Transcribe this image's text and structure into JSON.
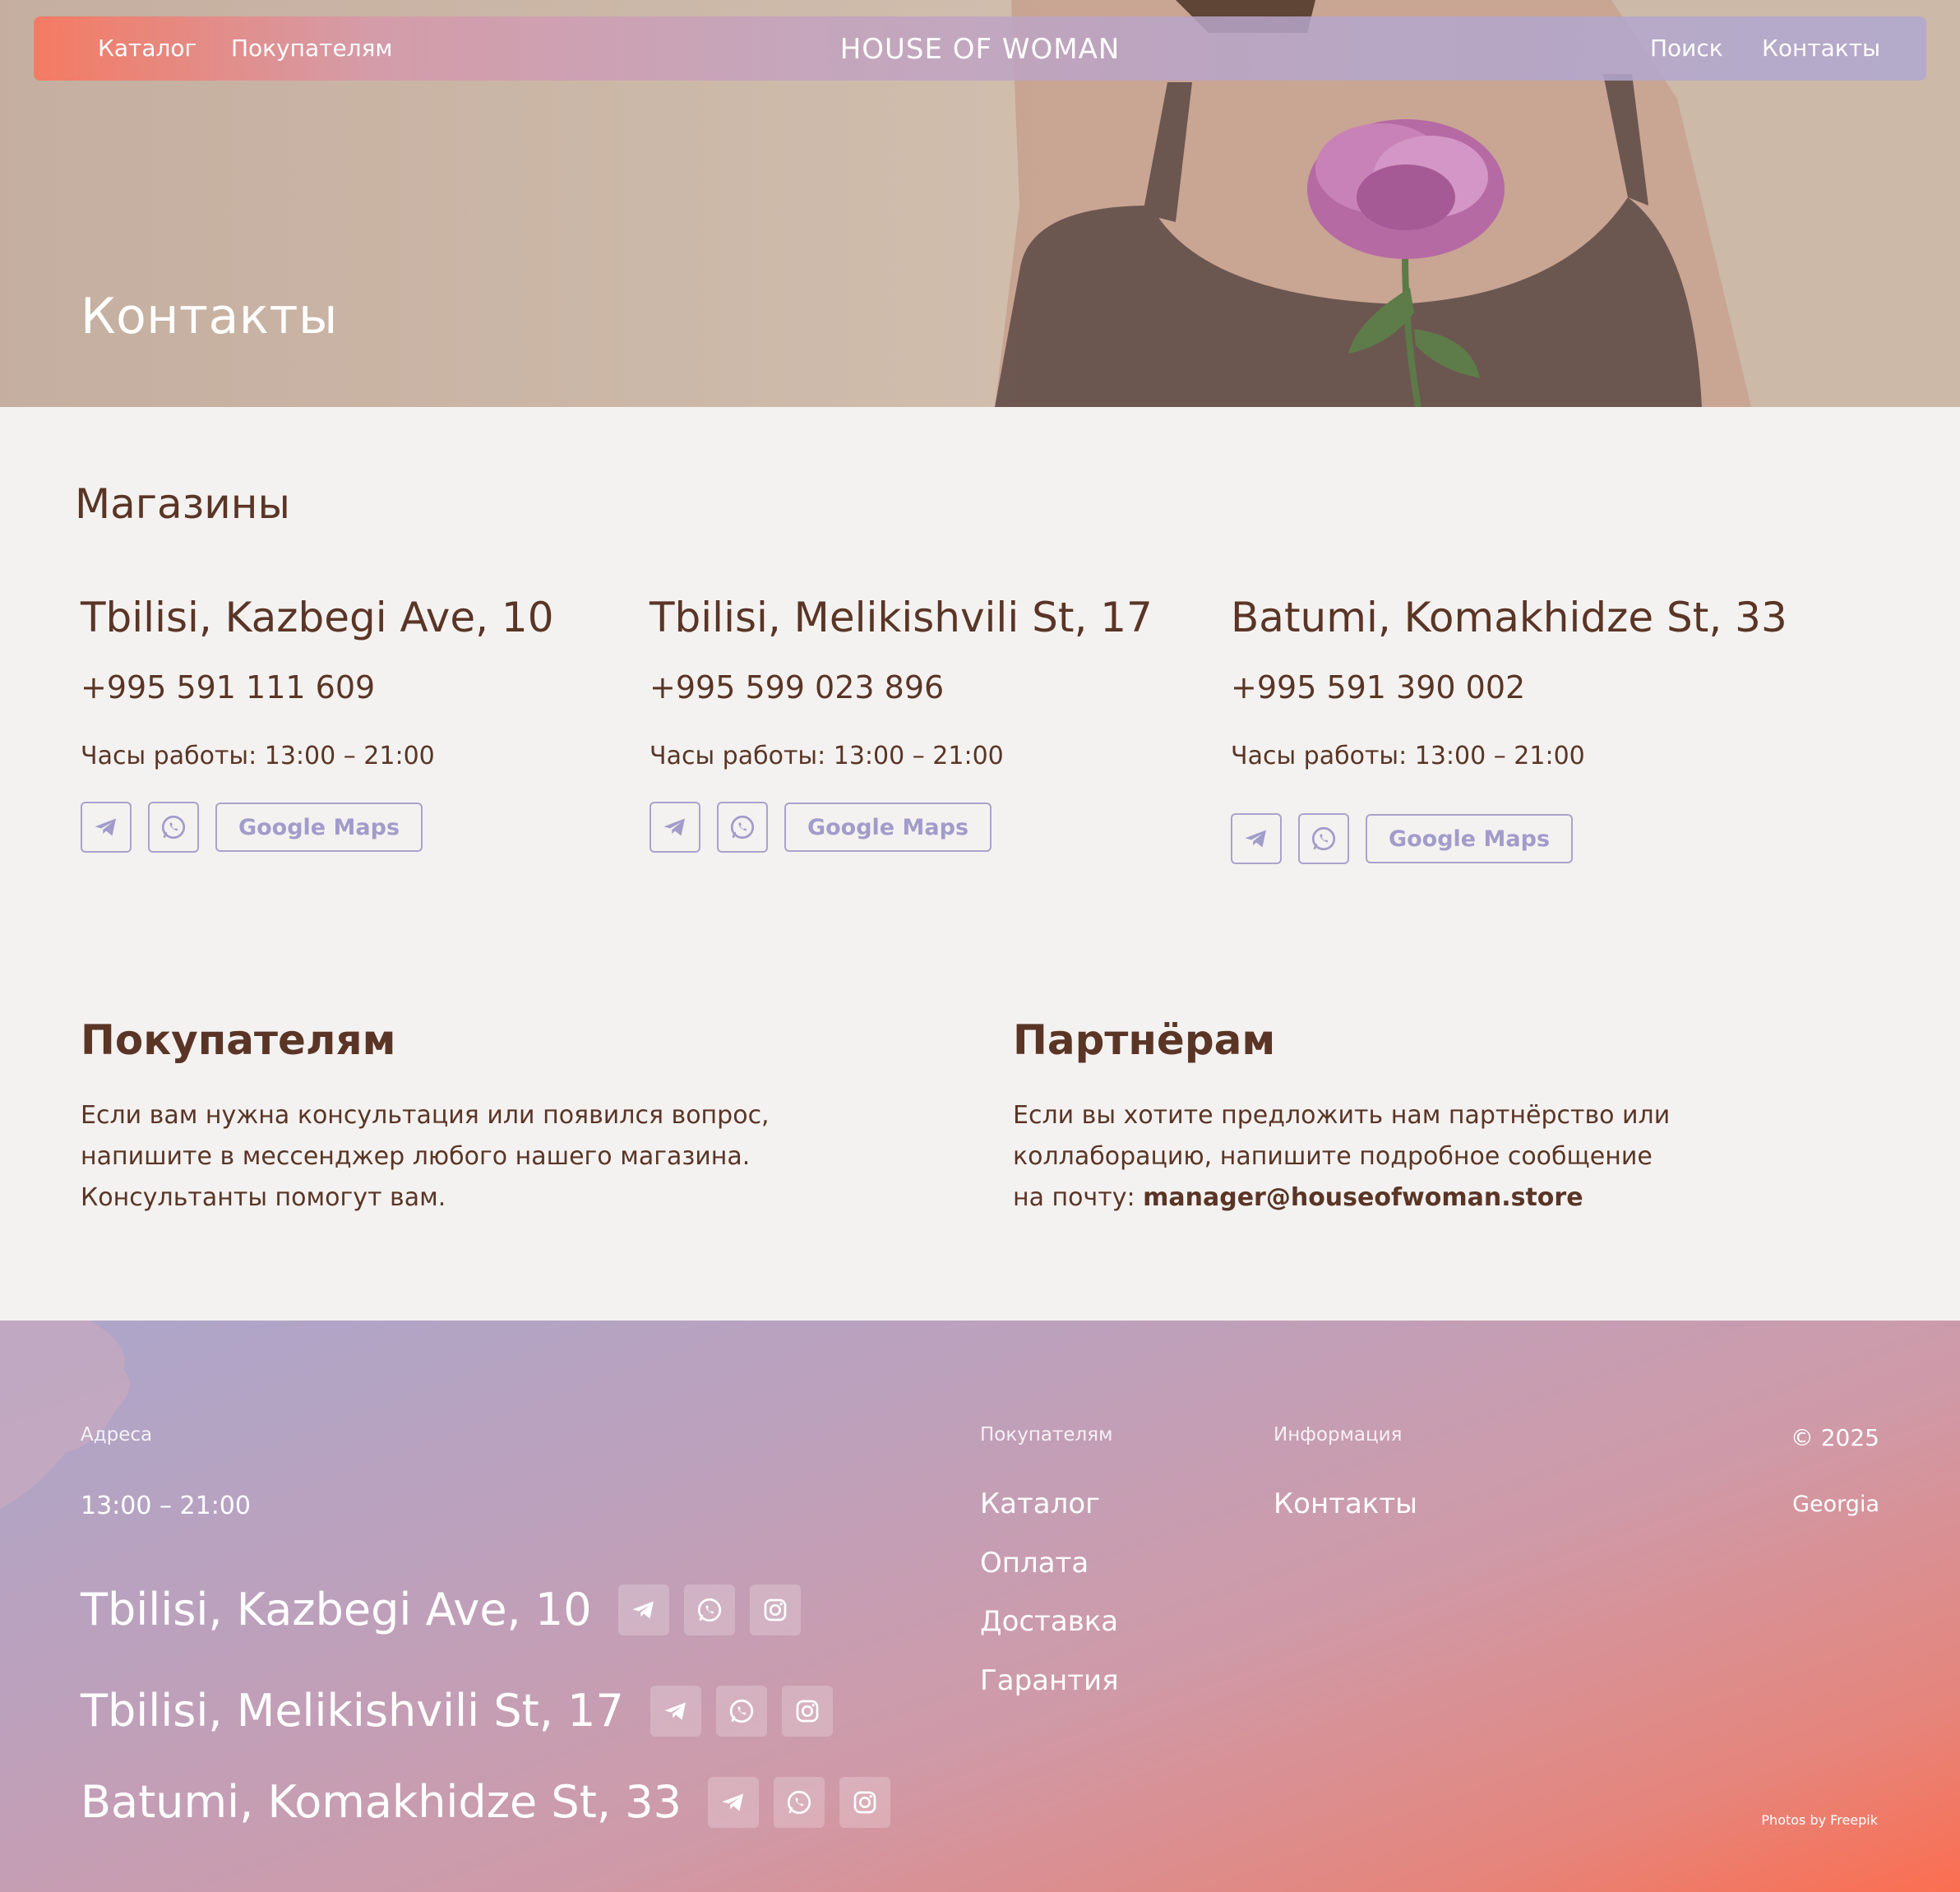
{
  "nav": {
    "catalog": "Каталог",
    "customers": "Покупателям",
    "brand": "HOUSE OF WOMAN",
    "search": "Поиск",
    "contacts": "Контакты"
  },
  "hero": {
    "title": "Контакты"
  },
  "stores": {
    "title": "Магазины",
    "items": [
      {
        "name": "Tbilisi, Kazbegi Ave, 10",
        "phone": "+995 591 111 609",
        "hours": "Часы работы: 13:00 – 21:00",
        "maps": "Google Maps"
      },
      {
        "name": "Tbilisi, Melikishvili St, 17",
        "phone": "+995 599 023 896",
        "hours": "Часы работы: 13:00 – 21:00",
        "maps": "Google Maps"
      },
      {
        "name": "Batumi, Komakhidze St, 33",
        "phone": "+995 591 390 002",
        "hours": "Часы работы: 13:00 – 21:00",
        "maps": "Google Maps"
      }
    ]
  },
  "customers": {
    "title": "Покупателям",
    "line1": "Если вам нужна консультация или появился вопрос,",
    "line2": "напишите в мессенджер любого нашего магазина.",
    "line3": "Консультанты помогут вам."
  },
  "partners": {
    "title": "Партнёрам",
    "line1": "Если вы хотите предложить нам партнёрство или",
    "line2": "коллаборацию, напишите подробное сообщение",
    "line3_prefix": "на почту: ",
    "email": "manager@houseofwoman.store"
  },
  "footer": {
    "addresses_label": "Адреса",
    "hours": "13:00 – 21:00",
    "addresses": [
      "Tbilisi, Kazbegi Ave, 10",
      "Tbilisi, Melikishvili St, 17",
      "Batumi, Komakhidze St, 33"
    ],
    "customers_label": "Покупателям",
    "customers_links": [
      "Каталог",
      "Оплата",
      "Доставка",
      "Гарантия"
    ],
    "info_label": "Информация",
    "info_links": [
      "Контакты"
    ],
    "copyright": "© 2025",
    "country": "Georgia",
    "credit": "Photos by Freepik"
  },
  "colors": {
    "text_brown": "#5a3526",
    "accent_lilac": "#a29ccb",
    "footer_gradient_start": "#aca6ca",
    "footer_gradient_end": "#fb6e50"
  },
  "icons": [
    "telegram-icon",
    "whatsapp-icon",
    "instagram-icon"
  ]
}
